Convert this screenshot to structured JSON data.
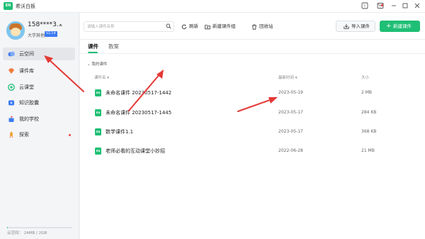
{
  "window": {
    "logo_text": "EN",
    "title": "希沃白板"
  },
  "user": {
    "name": "158****3...",
    "role": "大学其他",
    "badge": "V2.1#"
  },
  "sidebar": {
    "items": [
      {
        "label": "云空间",
        "icon": "cloud-icon",
        "color": "#3d7bf0",
        "active": true
      },
      {
        "label": "课件库",
        "icon": "gem-icon",
        "color": "#f07a3d",
        "active": false
      },
      {
        "label": "云课堂",
        "icon": "classroom-icon",
        "color": "#1fbf75",
        "active": false
      },
      {
        "label": "知识胶囊",
        "icon": "capsule-icon",
        "color": "#3d7bf0",
        "active": false
      },
      {
        "label": "我的学校",
        "icon": "school-icon",
        "color": "#3d7bf0",
        "active": false
      },
      {
        "label": "探索",
        "icon": "rocket-icon",
        "color": "#f0a43d",
        "active": false
      }
    ],
    "storage": {
      "label": "云空间：",
      "used": "24MB",
      "total": "2GB",
      "text": "云空间：  24MB / 2GB",
      "fraction": 0.012
    }
  },
  "toolbar": {
    "search_placeholder": "请输入课件名称",
    "refresh_label": "刷新",
    "new_group_label": "新建课件组",
    "recycle_label": "回收站",
    "import_label": "导入课件",
    "new_label": "新建课件"
  },
  "tabs": [
    {
      "label": "课件",
      "active": true
    },
    {
      "label": "教案",
      "active": false
    }
  ],
  "breadcrumb": "我的课件",
  "columns": {
    "name": "课件名 ▾",
    "updated": "最新时间 ▾",
    "size": "大小"
  },
  "files": [
    {
      "icon_text": "EN",
      "name": "未命名课件 20230517-1442",
      "updated": "2023-05-19",
      "size": "2 MB"
    },
    {
      "icon_text": "EN",
      "name": "未命名课件 20230517-1445",
      "updated": "2023-05-17",
      "size": "284 KB"
    },
    {
      "icon_text": "EN",
      "name": "数学课件1.1",
      "updated": "2023-05-17",
      "size": "368 KB"
    },
    {
      "icon_text": "EN",
      "name": "老师必看的互动课堂小妙招",
      "updated": "2022-06-28",
      "size": "21 MB"
    }
  ],
  "colors": {
    "accent": "#1fbf75",
    "annotation_arrow": "#e53935"
  }
}
